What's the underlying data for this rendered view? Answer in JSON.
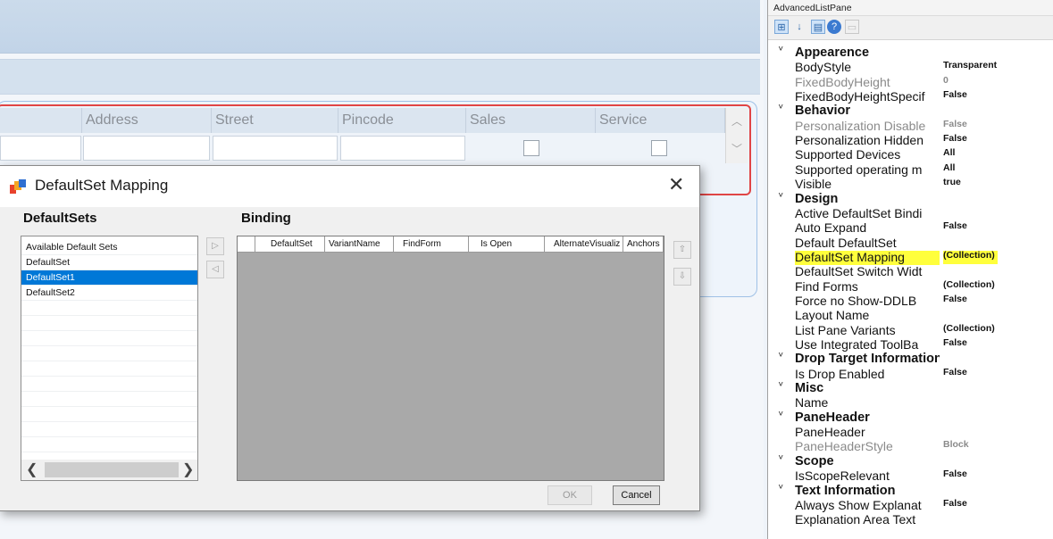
{
  "background": {
    "columns": [
      "Address",
      "Street",
      "Pincode",
      "Sales",
      "Service"
    ]
  },
  "dialog": {
    "title": "DefaultSet Mapping",
    "left_header": "DefaultSets",
    "right_header": "Binding",
    "list_items": [
      "Available Default Sets",
      "DefaultSet",
      "DefaultSet1",
      "DefaultSet2"
    ],
    "selected_item": "DefaultSet1",
    "grid_columns": [
      "DefaultSet",
      "VariantName",
      "FindForm",
      "Is Open",
      "AlternateVisualiz",
      "Anchors"
    ],
    "ok_label": "OK",
    "cancel_label": "Cancel",
    "close_glyph": "✕"
  },
  "properties": {
    "title": "AdvancedListPane",
    "rows": [
      {
        "kind": "cat",
        "name": "Appearence",
        "value": ""
      },
      {
        "kind": "prop",
        "name": "BodyStyle",
        "value": "Transparent"
      },
      {
        "kind": "prop",
        "name": "FixedBodyHeight",
        "value": "0",
        "dim": true
      },
      {
        "kind": "prop",
        "name": "FixedBodyHeightSpecif",
        "value": "False"
      },
      {
        "kind": "cat",
        "name": "Behavior",
        "value": ""
      },
      {
        "kind": "prop",
        "name": "Personalization Disable",
        "value": "False",
        "dim": true
      },
      {
        "kind": "prop",
        "name": "Personalization Hidden",
        "value": "False"
      },
      {
        "kind": "prop",
        "name": "Supported Devices",
        "value": "All"
      },
      {
        "kind": "prop",
        "name": "Supported operating m",
        "value": "All"
      },
      {
        "kind": "prop",
        "name": "Visible",
        "value": "true"
      },
      {
        "kind": "cat",
        "name": "Design",
        "value": ""
      },
      {
        "kind": "prop",
        "name": "Active DefaultSet Bindi",
        "value": ""
      },
      {
        "kind": "prop",
        "name": "Auto Expand",
        "value": "False"
      },
      {
        "kind": "prop",
        "name": "Default DefaultSet",
        "value": ""
      },
      {
        "kind": "prop",
        "name": "DefaultSet Mapping",
        "value": "(Collection)",
        "highlight": true
      },
      {
        "kind": "prop",
        "name": "DefaultSet Switch Widt",
        "value": ""
      },
      {
        "kind": "prop",
        "name": "Find Forms",
        "value": "(Collection)"
      },
      {
        "kind": "prop",
        "name": "Force no Show-DDLB",
        "value": "False"
      },
      {
        "kind": "prop",
        "name": "Layout Name",
        "value": ""
      },
      {
        "kind": "prop",
        "name": "List Pane Variants",
        "value": "(Collection)"
      },
      {
        "kind": "prop",
        "name": "Use Integrated ToolBa",
        "value": "False"
      },
      {
        "kind": "cat",
        "name": "Drop Target Information",
        "value": ""
      },
      {
        "kind": "prop",
        "name": "Is Drop Enabled",
        "value": "False"
      },
      {
        "kind": "cat",
        "name": "Misc",
        "value": ""
      },
      {
        "kind": "prop",
        "name": "Name",
        "value": ""
      },
      {
        "kind": "cat",
        "name": "PaneHeader",
        "value": ""
      },
      {
        "kind": "prop",
        "name": "PaneHeader",
        "value": ""
      },
      {
        "kind": "prop",
        "name": "PaneHeaderStyle",
        "value": "Block",
        "dim": true
      },
      {
        "kind": "cat",
        "name": "Scope",
        "value": ""
      },
      {
        "kind": "prop",
        "name": "IsScopeRelevant",
        "value": "False"
      },
      {
        "kind": "cat",
        "name": "Text Information",
        "value": ""
      },
      {
        "kind": "prop",
        "name": "Always Show Explanat",
        "value": "False"
      },
      {
        "kind": "prop",
        "name": "Explanation Area Text",
        "value": ""
      }
    ]
  },
  "colors": {
    "highlight": "#ffff3c",
    "selection": "#0078d7",
    "grid_bg": "#a9a9a9",
    "border_red": "#e04545"
  }
}
